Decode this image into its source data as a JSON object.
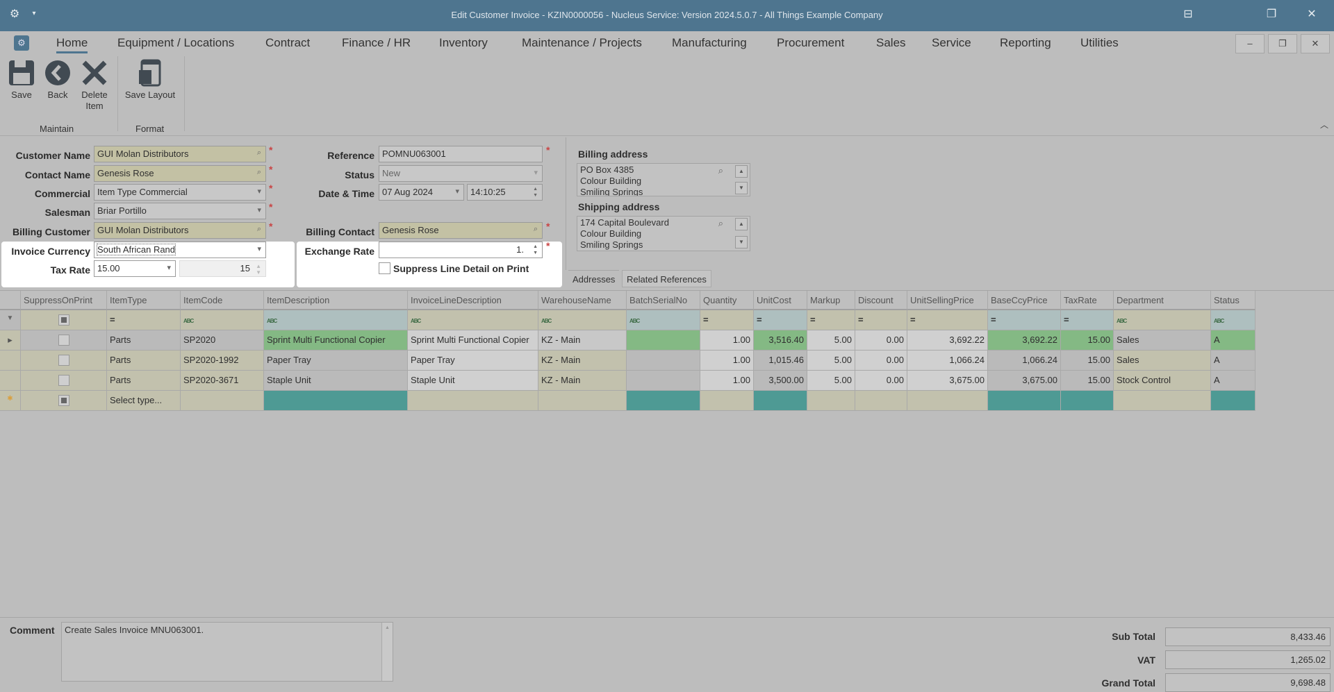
{
  "window": {
    "title": "Edit Customer Invoice - KZIN0000056 - Nucleus Service: Version 2024.5.0.7 - All Things Example Company"
  },
  "menu": {
    "tabs": [
      "Home",
      "Equipment / Locations",
      "Contract",
      "Finance / HR",
      "Inventory",
      "Maintenance / Projects",
      "Manufacturing",
      "Procurement",
      "Sales",
      "Service",
      "Reporting",
      "Utilities"
    ],
    "active": "Home"
  },
  "ribbon": {
    "save": "Save",
    "back": "Back",
    "delete_1": "Delete",
    "delete_2": "Item",
    "save_layout": "Save Layout",
    "group_maintain": "Maintain",
    "group_format": "Format"
  },
  "form": {
    "customer_name": {
      "label": "Customer Name",
      "value": "GUI Molan Distributors"
    },
    "contact_name": {
      "label": "Contact Name",
      "value": "Genesis Rose"
    },
    "commercial": {
      "label": "Commercial",
      "value": "Item Type Commercial"
    },
    "salesman": {
      "label": "Salesman",
      "value": "Briar Portillo"
    },
    "billing_customer": {
      "label": "Billing Customer",
      "value": "GUI Molan Distributors"
    },
    "invoice_currency": {
      "label": "Invoice Currency",
      "value": "South African Rand"
    },
    "tax_rate": {
      "label": "Tax Rate",
      "value": "15.00",
      "spin_value": "15"
    },
    "reference": {
      "label": "Reference",
      "value": "POMNU063001"
    },
    "status": {
      "label": "Status",
      "value": "New"
    },
    "date_time": {
      "label": "Date & Time",
      "date": "07 Aug 2024",
      "time": "14:10:25"
    },
    "billing_contact": {
      "label": "Billing Contact",
      "value": "Genesis Rose"
    },
    "exchange_rate": {
      "label": "Exchange Rate",
      "value": "1."
    },
    "suppress": {
      "label": "Suppress Line Detail on Print",
      "checked": false
    },
    "required_mark": "*"
  },
  "addresses": {
    "billing_label": "Billing address",
    "billing": [
      "PO Box 4385",
      "Colour Building",
      "Smiling Springs"
    ],
    "shipping_label": "Shipping address",
    "shipping": [
      "174 Capital Boulevard",
      "Colour Building",
      "Smiling Springs"
    ],
    "tabs": [
      "Addresses",
      "Related References"
    ]
  },
  "grid": {
    "columns": [
      "SuppressOnPrint",
      "ItemType",
      "ItemCode",
      "ItemDescription",
      "InvoiceLineDescription",
      "WarehouseName",
      "BatchSerialNo",
      "Quantity",
      "UnitCost",
      "Markup",
      "Discount",
      "UnitSellingPrice",
      "BaseCcyPrice",
      "TaxRate",
      "Department",
      "Status"
    ],
    "filter_eq": "=",
    "filter_abc": "ABC",
    "rows": [
      [
        "",
        "Parts",
        "SP2020",
        "Sprint Multi Functional Copier",
        "Sprint Multi Functional Copier",
        "KZ - Main",
        "",
        "1.00",
        "3,516.40",
        "5.00",
        "0.00",
        "3,692.22",
        "3,692.22",
        "15.00",
        "Sales",
        "A"
      ],
      [
        "",
        "Parts",
        "SP2020-1992",
        "Paper Tray",
        "Paper Tray",
        "KZ - Main",
        "",
        "1.00",
        "1,015.46",
        "5.00",
        "0.00",
        "1,066.24",
        "1,066.24",
        "15.00",
        "Sales",
        "A"
      ],
      [
        "",
        "Parts",
        "SP2020-3671",
        "Staple Unit",
        "Staple Unit",
        "KZ - Main",
        "",
        "1.00",
        "3,500.00",
        "5.00",
        "0.00",
        "3,675.00",
        "3,675.00",
        "15.00",
        "Stock Control",
        "A"
      ]
    ],
    "new_row_placeholder": "Select type..."
  },
  "footer": {
    "comment_label": "Comment",
    "comment": "Create Sales Invoice MNU063001.",
    "sub_total_label": "Sub Total",
    "sub_total": "8,433.46",
    "vat_label": "VAT",
    "vat": "1,265.02",
    "grand_total_label": "Grand Total",
    "grand_total": "9,698.48"
  },
  "colors": {
    "titlebar": "#4e758f",
    "required": "#c3c1a4",
    "green": "#84b984",
    "teal": "#4e9a94"
  }
}
